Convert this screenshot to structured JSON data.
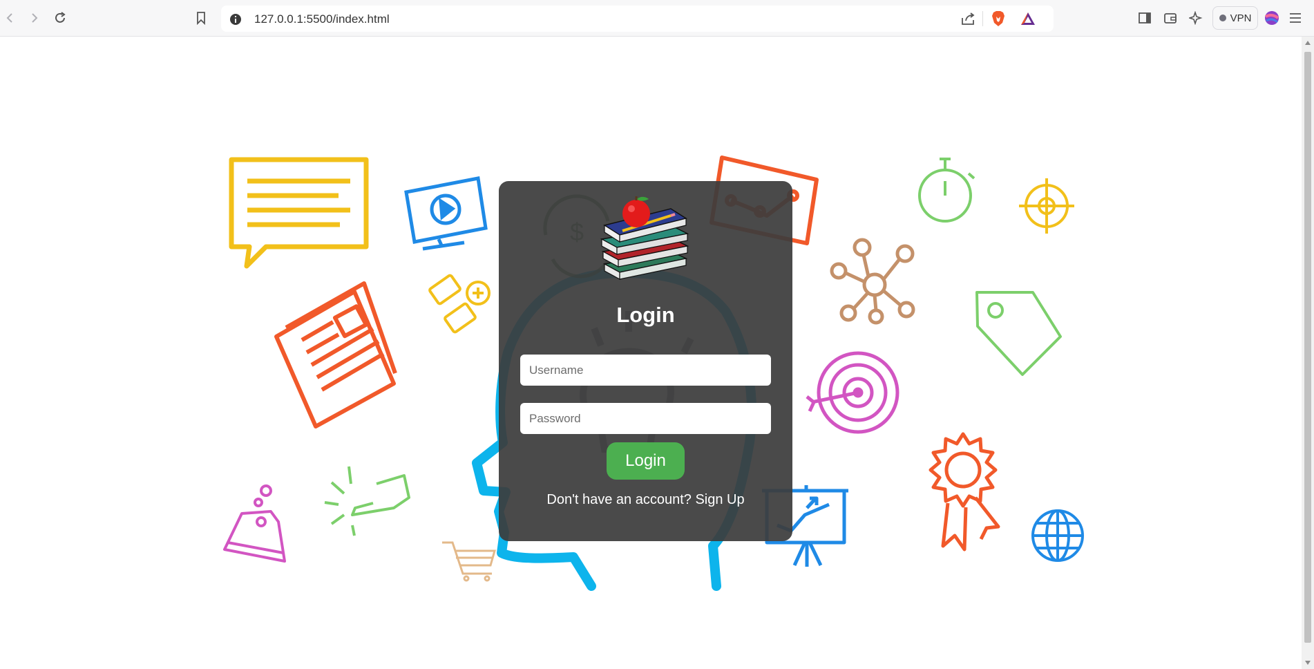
{
  "browser": {
    "url": "127.0.0.1:5500/index.html",
    "vpn_label": "VPN"
  },
  "login": {
    "title": "Login",
    "username_placeholder": "Username",
    "password_placeholder": "Password",
    "submit_label": "Login",
    "signup_prompt": "Don't have an account?",
    "signup_link": "Sign Up"
  },
  "icons": {
    "back": "back-arrow-icon",
    "forward": "forward-arrow-icon",
    "reload": "reload-icon",
    "bookmark": "bookmark-icon",
    "site_info": "info-icon",
    "share": "share-icon",
    "brave": "brave-shield-icon",
    "rewards": "rewards-triangle-icon",
    "sidebar": "sidebar-icon",
    "wallet": "wallet-icon",
    "leo": "sparkle-icon",
    "profile": "profile-avatar-icon",
    "menu": "hamburger-menu-icon"
  },
  "colors": {
    "card_bg": "#3c3c3c",
    "button": "#4caf50",
    "head_outline": "#0db4ec"
  }
}
